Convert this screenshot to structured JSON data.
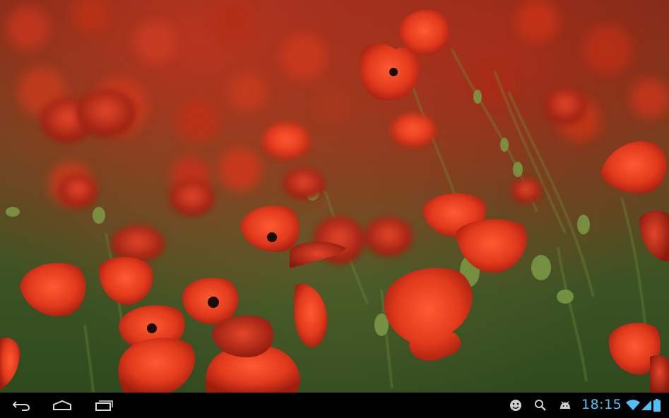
{
  "wallpaper": {
    "subject": "poppy-field-photo"
  },
  "navbar": {
    "back_icon": "back-icon",
    "home_icon": "home-icon",
    "recents_icon": "recent-apps-icon"
  },
  "status": {
    "time": "18:15",
    "accent_color": "#4fc3f7",
    "icons": [
      "face-icon",
      "search-icon",
      "android-icon",
      "wifi-icon",
      "signal-icon",
      "battery-icon"
    ]
  }
}
